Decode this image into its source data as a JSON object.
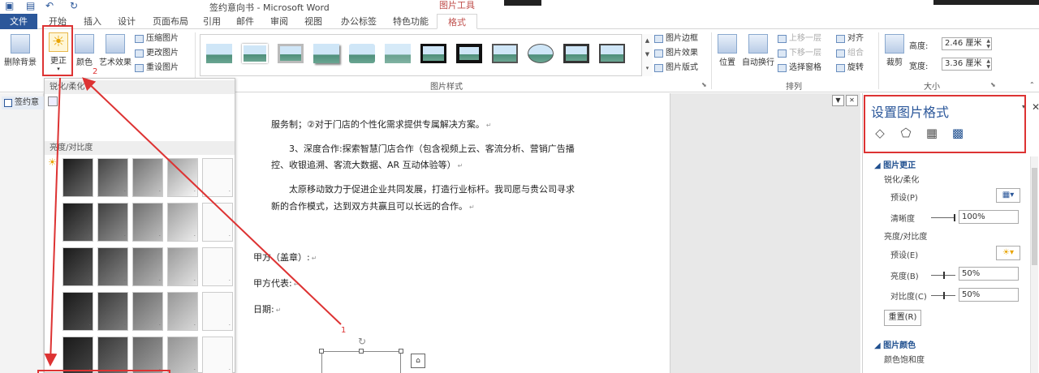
{
  "titlebar": {
    "doc_title": "签约意向书 - Microsoft Word",
    "tools_title": "图片工具"
  },
  "tabs": {
    "file": "文件",
    "items": [
      "开始",
      "插入",
      "设计",
      "页面布局",
      "引用",
      "邮件",
      "审阅",
      "视图",
      "办公标签",
      "特色功能",
      "格式"
    ]
  },
  "ribbon": {
    "remove_bg": "删除背景",
    "correct": "更正",
    "color": "颜色",
    "art": "艺术效果",
    "compress": "压缩图片",
    "change": "更改图片",
    "reset": "重设图片",
    "styles_label": "图片样式",
    "border": "图片边框",
    "effects": "图片效果",
    "layout": "图片版式",
    "position": "位置",
    "wrap": "自动换行",
    "bring_forward": "上移一层",
    "send_backward": "下移一层",
    "selection_pane": "选择窗格",
    "align": "对齐",
    "group": "组合",
    "rotate": "旋转",
    "arrange_label": "排列",
    "crop": "裁剪",
    "height_label": "高度:",
    "height_value": "2.46 厘米",
    "width_label": "宽度:",
    "width_value": "3.36 厘米",
    "size_label": "大小"
  },
  "annotations": {
    "label_1": "1",
    "label_2": "2"
  },
  "nav": {
    "tab": "签约意"
  },
  "dropdown": {
    "sharpen_header": "锐化/柔化",
    "brightness_header": "亮度/对比度"
  },
  "document": {
    "lines": [
      "服务制；②对于门店的个性化需求提供专属解决方案。",
      "3、深度合作:探索智慧门店合作（包含视频上云、客流分析、营销广告播",
      "控、收银追溯、客流大数据、AR 互动体验等）",
      "太原移动致力于促进企业共同发展，打造行业标杆。我司愿与贵公司寻求",
      "新的合作模式，达到双方共赢且可以长远的合作。",
      "甲方（盖章）:",
      "甲方代表:",
      "日期:"
    ]
  },
  "pane": {
    "title": "设置图片格式",
    "sec_correction": "图片更正",
    "sub_sharpen": "锐化/柔化",
    "preset1": "预设(P)",
    "clarity_label": "清晰度",
    "clarity_value": "100%",
    "sub_brightness": "亮度/对比度",
    "preset2": "预设(E)",
    "brightness_label": "亮度(B)",
    "brightness_value": "50%",
    "contrast_label": "对比度(C)",
    "contrast_value": "50%",
    "reset_btn": "重置(R)",
    "sec_color": "图片颜色",
    "sub_saturation": "颜色饱和度"
  },
  "icons": {
    "correct": "sun-icon",
    "fill": "paint-bucket-icon",
    "effects": "pentagon-icon",
    "layout": "layout-icon",
    "picture": "picture-icon"
  },
  "colors": {
    "accent": "#2b579a",
    "annotation": "#dd3333",
    "tools": "#c0504d"
  }
}
